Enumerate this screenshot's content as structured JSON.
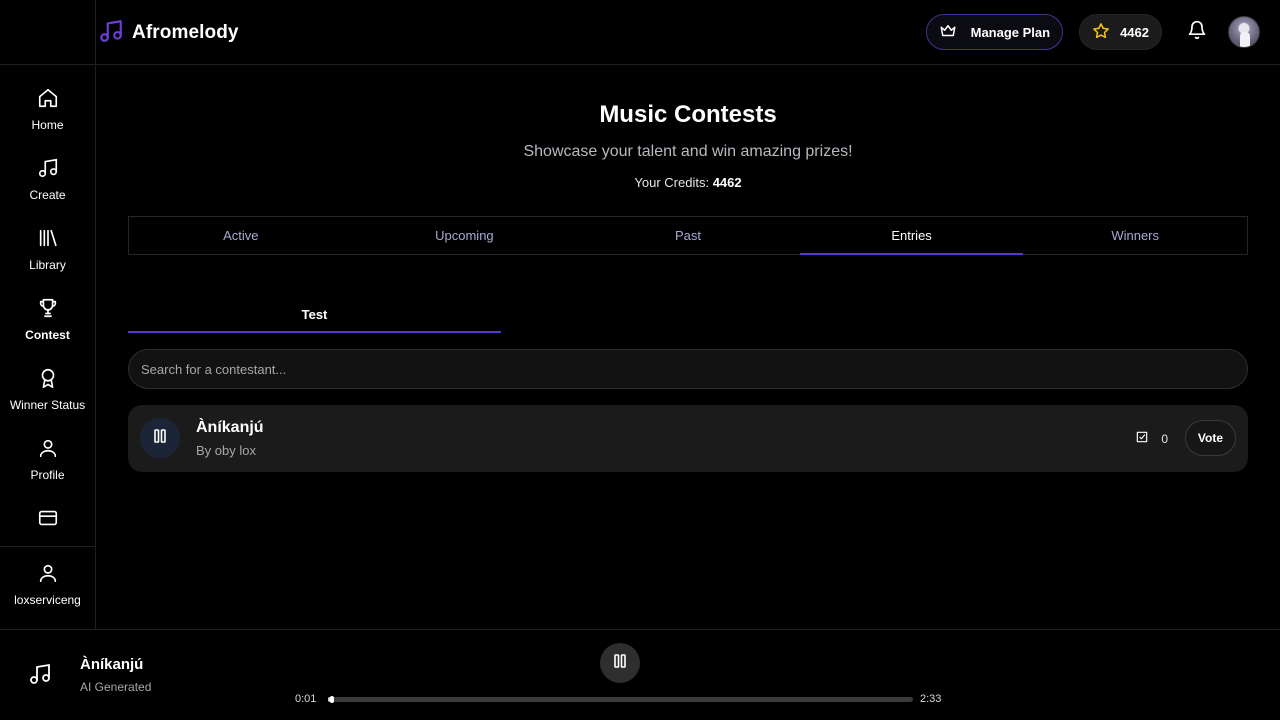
{
  "app": {
    "name": "Afromelody",
    "accent": "#5b35c9"
  },
  "header": {
    "manage_plan_label": "Manage Plan",
    "credits": "4462",
    "icons": [
      "crown-icon",
      "star-icon",
      "bell-icon"
    ]
  },
  "sidebar": {
    "items": [
      {
        "label": "Home",
        "icon": "home-icon",
        "active": false
      },
      {
        "label": "Create",
        "icon": "music-note-icon",
        "active": false
      },
      {
        "label": "Library",
        "icon": "library-icon",
        "active": false
      },
      {
        "label": "Contest",
        "icon": "trophy-icon",
        "active": true
      },
      {
        "label": "Winner Status",
        "icon": "award-icon",
        "active": false
      },
      {
        "label": "Profile",
        "icon": "user-icon",
        "active": false
      },
      {
        "label": "",
        "icon": "credit-card-icon",
        "active": false
      }
    ],
    "account": {
      "label": "loxserviceng",
      "icon": "user-icon"
    }
  },
  "main": {
    "title": "Music Contests",
    "subtitle": "Showcase your talent and win amazing prizes!",
    "credits_label": "Your Credits:",
    "credits_value": "4462",
    "tabs": [
      {
        "label": "Active",
        "active": false
      },
      {
        "label": "Upcoming",
        "active": false
      },
      {
        "label": "Past",
        "active": false
      },
      {
        "label": "Entries",
        "active": true
      },
      {
        "label": "Winners",
        "active": false
      }
    ],
    "contest_tab": "Test",
    "search": {
      "placeholder": "Search for a contestant...",
      "value": ""
    },
    "entries": [
      {
        "title": "Àníkanjú",
        "by": "By oby lox",
        "votes": "0",
        "vote_label": "Vote",
        "playing": true
      }
    ]
  },
  "player": {
    "title": "Àníkanjú",
    "subtitle": "AI Generated",
    "current_time": "0:01",
    "duration": "2:33",
    "progress": 0.006,
    "state": "playing"
  }
}
